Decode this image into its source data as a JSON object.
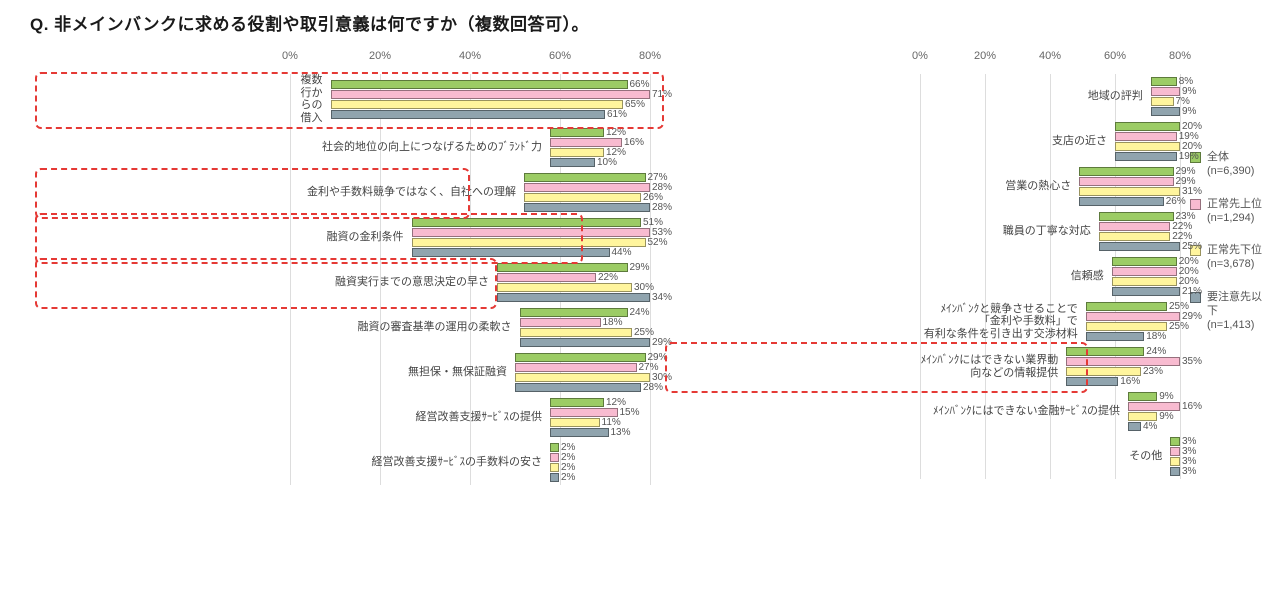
{
  "title": "Q.  非メインバンクに求める役割や取引意義は何ですか（複数回答可）。",
  "axis_max": 80,
  "ticks": [
    0,
    20,
    40,
    60,
    80
  ],
  "series_colors": [
    "c0",
    "c1",
    "c2",
    "c3"
  ],
  "legend": [
    {
      "name": "全体",
      "n": "(n=6,390)"
    },
    {
      "name": "正常先上位",
      "n": "(n=1,294)"
    },
    {
      "name": "正常先下位",
      "n": "(n=3,678)"
    },
    {
      "name": "要注意先以下",
      "n": "(n=1,413)"
    }
  ],
  "left_rows": [
    {
      "label": "複数行からの借入",
      "v": [
        66,
        71,
        65,
        61
      ],
      "hl": true
    },
    {
      "label": "社会的地位の向上につなげるためのﾌﾞﾗﾝﾄﾞ力",
      "v": [
        12,
        16,
        12,
        10
      ]
    },
    {
      "label": "金利や手数料競争ではなく、自社への理解",
      "v": [
        27,
        28,
        26,
        28
      ],
      "hl": true
    },
    {
      "label": "融資の金利条件",
      "v": [
        51,
        53,
        52,
        44
      ],
      "hl": true
    },
    {
      "label": "融資実行までの意思決定の早さ",
      "v": [
        29,
        22,
        30,
        34
      ],
      "hl": true
    },
    {
      "label": "融資の審査基準の運用の柔軟さ",
      "v": [
        24,
        18,
        25,
        29
      ]
    },
    {
      "label": "無担保・無保証融資",
      "v": [
        29,
        27,
        30,
        28
      ]
    },
    {
      "label": "経営改善支援ｻｰﾋﾞｽの提供",
      "v": [
        12,
        15,
        11,
        13
      ]
    },
    {
      "label": "経営改善支援ｻｰﾋﾞｽの手数料の安さ",
      "v": [
        2,
        2,
        2,
        2
      ]
    }
  ],
  "right_rows": [
    {
      "label": "地域の評判",
      "v": [
        8,
        9,
        7,
        9
      ]
    },
    {
      "label": "支店の近さ",
      "v": [
        20,
        19,
        20,
        19
      ]
    },
    {
      "label": "営業の熱心さ",
      "v": [
        29,
        29,
        31,
        26
      ]
    },
    {
      "label": "職員の丁寧な対応",
      "v": [
        23,
        22,
        22,
        25
      ]
    },
    {
      "label": "信頼感",
      "v": [
        20,
        20,
        20,
        21
      ]
    },
    {
      "label": "ﾒｲﾝﾊﾞﾝｸと競争させることで「金利や手数料」で\n有利な条件を引き出す交渉材料",
      "v": [
        25,
        29,
        25,
        18
      ]
    },
    {
      "label": "ﾒｲﾝﾊﾞﾝｸにはできない業界動向などの情報提供",
      "v": [
        24,
        35,
        23,
        16
      ],
      "hl": true
    },
    {
      "label": "ﾒｲﾝﾊﾞﾝｸにはできない金融ｻｰﾋﾞｽの提供",
      "v": [
        9,
        16,
        9,
        4
      ]
    },
    {
      "label": "その他",
      "v": [
        3,
        3,
        3,
        3
      ]
    }
  ],
  "chart_data": {
    "type": "bar",
    "orientation": "horizontal",
    "xlabel": "",
    "ylabel": "",
    "xlim": [
      0,
      80
    ],
    "unit": "%",
    "series": [
      {
        "name": "全体",
        "n": 6390
      },
      {
        "name": "正常先上位",
        "n": 1294
      },
      {
        "name": "正常先下位",
        "n": 3678
      },
      {
        "name": "要注意先以下",
        "n": 1413
      }
    ],
    "categories": [
      "複数行からの借入",
      "社会的地位の向上につなげるためのﾌﾞﾗﾝﾄﾞ力",
      "金利や手数料競争ではなく、自社への理解",
      "融資の金利条件",
      "融資実行までの意思決定の早さ",
      "融資の審査基準の運用の柔軟さ",
      "無担保・無保証融資",
      "経営改善支援ｻｰﾋﾞｽの提供",
      "経営改善支援ｻｰﾋﾞｽの手数料の安さ",
      "地域の評判",
      "支店の近さ",
      "営業の熱心さ",
      "職員の丁寧な対応",
      "信頼感",
      "ﾒｲﾝﾊﾞﾝｸと競争させることで「金利や手数料」で有利な条件を引き出す交渉材料",
      "ﾒｲﾝﾊﾞﾝｸにはできない業界動向などの情報提供",
      "ﾒｲﾝﾊﾞﾝｸにはできない金融ｻｰﾋﾞｽの提供",
      "その他"
    ],
    "values_by_series": {
      "全体": [
        66,
        12,
        27,
        51,
        29,
        24,
        29,
        12,
        2,
        8,
        20,
        29,
        23,
        20,
        25,
        24,
        9,
        3
      ],
      "正常先上位": [
        71,
        16,
        28,
        53,
        22,
        18,
        27,
        15,
        2,
        9,
        19,
        29,
        22,
        20,
        29,
        35,
        16,
        3
      ],
      "正常先下位": [
        65,
        12,
        26,
        52,
        30,
        25,
        30,
        11,
        2,
        7,
        20,
        31,
        22,
        20,
        25,
        23,
        9,
        3
      ],
      "要注意先以下": [
        61,
        10,
        28,
        44,
        34,
        29,
        28,
        13,
        2,
        9,
        19,
        26,
        25,
        21,
        18,
        16,
        4,
        3
      ]
    },
    "highlighted_categories": [
      "複数行からの借入",
      "金利や手数料競争ではなく、自社への理解",
      "融資の金利条件",
      "融資実行までの意思決定の早さ",
      "ﾒｲﾝﾊﾞﾝｸにはできない業界動向などの情報提供"
    ]
  }
}
